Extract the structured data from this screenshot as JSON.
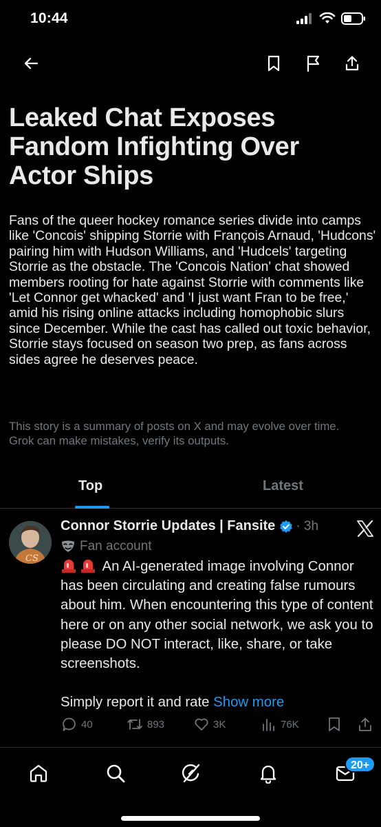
{
  "status_bar": {
    "time": "10:44"
  },
  "article": {
    "headline": "Leaked Chat Exposes Fandom Infighting Over Actor Ships",
    "summary": "Fans of the queer hockey romance series divide into camps like 'Concois' shipping Storrie with François Arnaud, 'Hudcons' pairing him with Hudson Williams, and 'Hudcels' targeting Storrie as the obstacle. The 'Concois Nation' chat showed members rooting for hate against Storrie with comments like 'Let Connor get whacked' and 'I just want Fran to be free,' amid his rising online attacks including homophobic slurs since December. While the cast has called out toxic behavior, Storrie stays focused on season two prep, as fans across sides agree he deserves peace.",
    "disclaimer": "This story is a summary of posts on X and may evolve over time. Grok can make mistakes, verify its outputs."
  },
  "tabs": {
    "top": "Top",
    "latest": "Latest",
    "active": "Top"
  },
  "post": {
    "avatar_initials": "CS",
    "author": "Connor Storrie Updates | Fansite",
    "time": "3h",
    "label": "Fan account",
    "body": "An AI-generated image involving Connor has been circulating and creating false rumours about him. When encountering this type of content here or on any other social network, we ask you to please DO NOT interact, like, share, or take screenshots.",
    "body2": "Simply report it and rate",
    "show_more": "Show more",
    "replies": "40",
    "reposts": "893",
    "likes": "3K",
    "views": "76K"
  },
  "bottom_nav": {
    "badge": "20+"
  },
  "colors": {
    "accent": "#1d9bf0",
    "muted": "#71767b",
    "divider": "#2f3336",
    "verified": "#1d9bf0"
  },
  "icons": [
    "back-arrow-icon",
    "bookmark-icon",
    "flag-icon",
    "share-icon",
    "verified-badge-icon",
    "x-logo-icon",
    "mask-icon",
    "siren-icon",
    "reply-icon",
    "repost-icon",
    "like-icon",
    "views-icon",
    "home-icon",
    "search-icon",
    "grok-icon",
    "notifications-icon",
    "messages-icon"
  ]
}
